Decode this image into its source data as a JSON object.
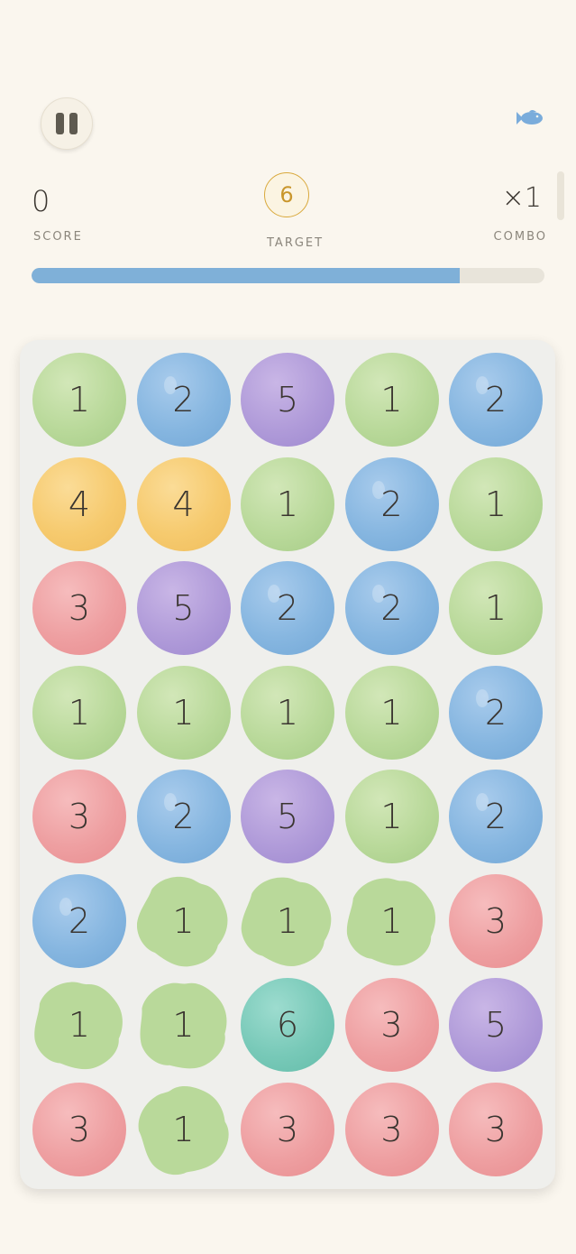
{
  "header": {
    "pause_icon": "pause-icon",
    "fish_icon": "fish-icon",
    "fish_color": "#7aacdb"
  },
  "stats": {
    "score_value": "0",
    "score_label": "SCORE",
    "target_value": "6",
    "target_label": "TARGET",
    "combo_value": "×1",
    "combo_label": "COMBO"
  },
  "progress": {
    "fraction": 0.835,
    "color": "#7fb0d8"
  },
  "colors": {
    "green": "#b9d99a",
    "blue": "#86b6e0",
    "purple": "#b09bd9",
    "yellow": "#f6ca6e",
    "red": "#ee9fa1",
    "teal": "#78c9b8",
    "board": "#efefec",
    "background": "#faf6ee"
  },
  "board": {
    "columns": 5,
    "rows": [
      [
        {
          "v": "1",
          "c": "green"
        },
        {
          "v": "2",
          "c": "blue"
        },
        {
          "v": "5",
          "c": "purple"
        },
        {
          "v": "1",
          "c": "green"
        },
        {
          "v": "2",
          "c": "blue"
        }
      ],
      [
        {
          "v": "4",
          "c": "yellow"
        },
        {
          "v": "4",
          "c": "yellow"
        },
        {
          "v": "1",
          "c": "green"
        },
        {
          "v": "2",
          "c": "blue"
        },
        {
          "v": "1",
          "c": "green"
        }
      ],
      [
        {
          "v": "3",
          "c": "red"
        },
        {
          "v": "5",
          "c": "purple"
        },
        {
          "v": "2",
          "c": "blue"
        },
        {
          "v": "2",
          "c": "blue"
        },
        {
          "v": "1",
          "c": "green"
        }
      ],
      [
        {
          "v": "1",
          "c": "green"
        },
        {
          "v": "1",
          "c": "green"
        },
        {
          "v": "1",
          "c": "green"
        },
        {
          "v": "1",
          "c": "green"
        },
        {
          "v": "2",
          "c": "blue"
        }
      ],
      [
        {
          "v": "3",
          "c": "red"
        },
        {
          "v": "2",
          "c": "blue"
        },
        {
          "v": "5",
          "c": "purple"
        },
        {
          "v": "1",
          "c": "green"
        },
        {
          "v": "2",
          "c": "blue"
        }
      ],
      [
        {
          "v": "2",
          "c": "blue"
        },
        {
          "v": "1",
          "c": "green",
          "blob": true
        },
        {
          "v": "1",
          "c": "green",
          "blob": true
        },
        {
          "v": "1",
          "c": "green",
          "blob": true
        },
        {
          "v": "3",
          "c": "red"
        }
      ],
      [
        {
          "v": "1",
          "c": "green",
          "blob": true
        },
        {
          "v": "1",
          "c": "green",
          "blob": true
        },
        {
          "v": "6",
          "c": "teal"
        },
        {
          "v": "3",
          "c": "red"
        },
        {
          "v": "5",
          "c": "purple"
        }
      ],
      [
        {
          "v": "3",
          "c": "red"
        },
        {
          "v": "1",
          "c": "green",
          "blob": true
        },
        {
          "v": "3",
          "c": "red"
        },
        {
          "v": "3",
          "c": "red"
        },
        {
          "v": "3",
          "c": "red"
        }
      ]
    ]
  }
}
